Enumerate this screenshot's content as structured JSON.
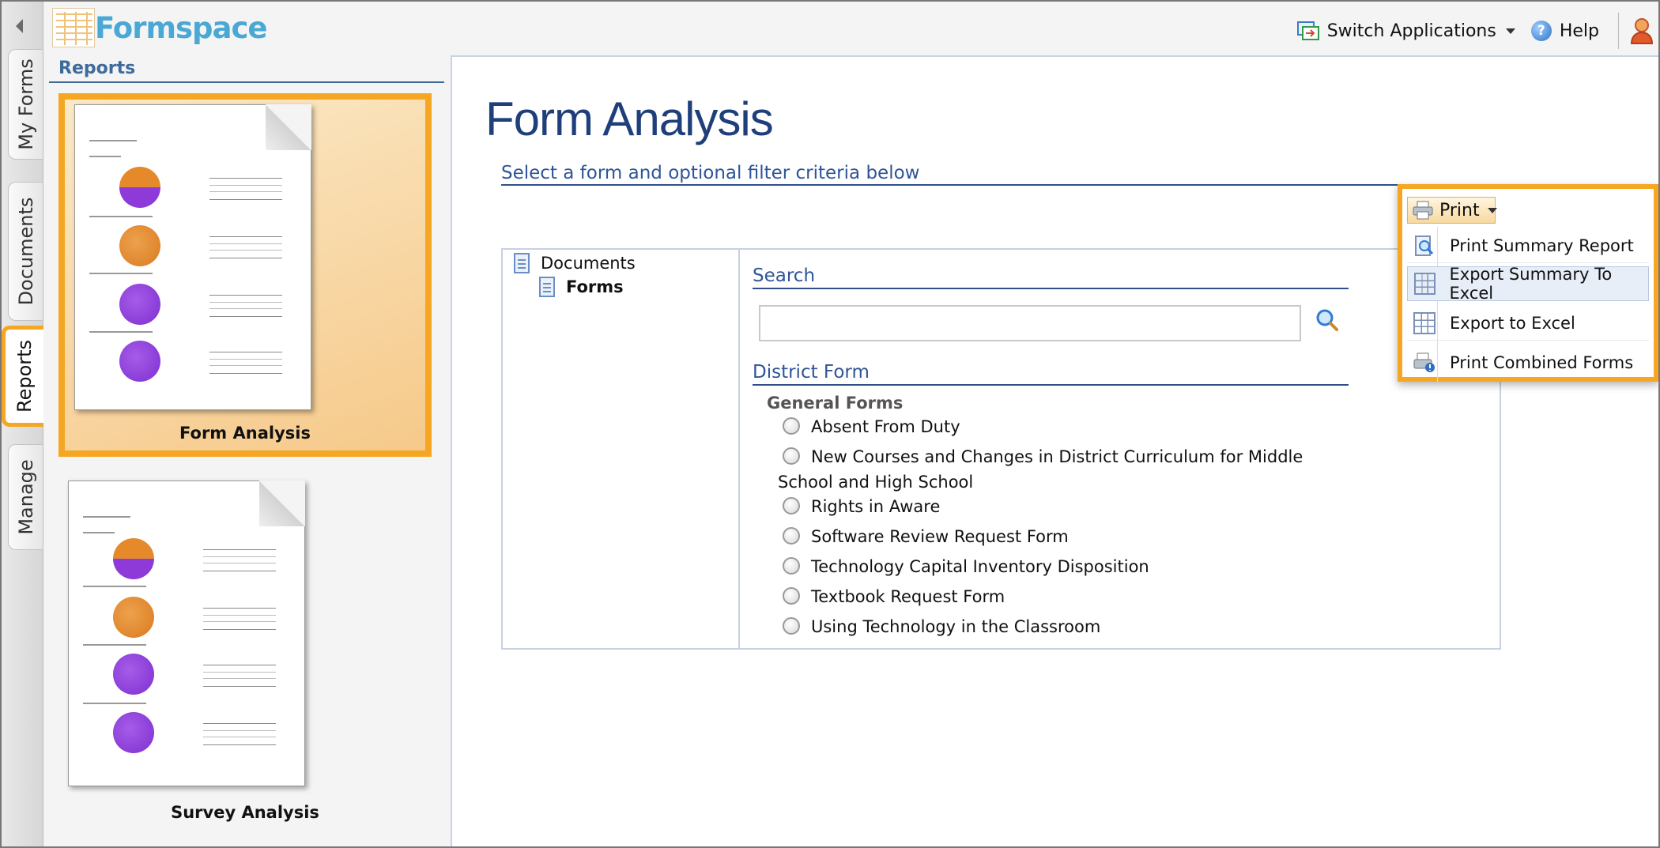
{
  "app": {
    "name": "Formspace"
  },
  "topbar": {
    "switch_label": "Switch Applications",
    "help_label": "Help"
  },
  "vtabs": [
    {
      "label": "My Forms",
      "active": false
    },
    {
      "label": "Documents",
      "active": false
    },
    {
      "label": "Reports",
      "active": true
    },
    {
      "label": "Manage",
      "active": false
    }
  ],
  "left_panel": {
    "heading": "Reports",
    "reports": [
      {
        "label": "Form Analysis",
        "selected": true
      },
      {
        "label": "Survey Analysis",
        "selected": false
      }
    ]
  },
  "main": {
    "title": "Form Analysis",
    "subtitle": "Select a form and optional filter criteria below",
    "tree": {
      "root": "Documents",
      "child": "Forms"
    },
    "search": {
      "title": "Search",
      "value": "",
      "placeholder": ""
    },
    "district": {
      "title": "District Form",
      "group": "General Forms",
      "forms": [
        "Absent From Duty",
        "New Courses and Changes in District Curriculum for Middle",
        "Rights in Aware",
        "Software Review Request Form",
        "Technology Capital Inventory Disposition",
        "Textbook Request Form",
        "Using Technology in the Classroom"
      ],
      "wrap_text": "School and High School"
    }
  },
  "print_menu": {
    "button": "Print",
    "items": [
      {
        "label": "Print Summary Report",
        "icon": "preview-icon"
      },
      {
        "label": "Export Summary To Excel",
        "icon": "grid-icon"
      },
      {
        "label": "Export to Excel",
        "icon": "grid-icon"
      },
      {
        "label": "Print Combined Forms",
        "icon": "print-combined-icon"
      }
    ]
  },
  "colors": {
    "accent": "#f5a623",
    "title": "#1f3f7a",
    "link": "#2f5597",
    "logo": "#4aa8d4"
  }
}
